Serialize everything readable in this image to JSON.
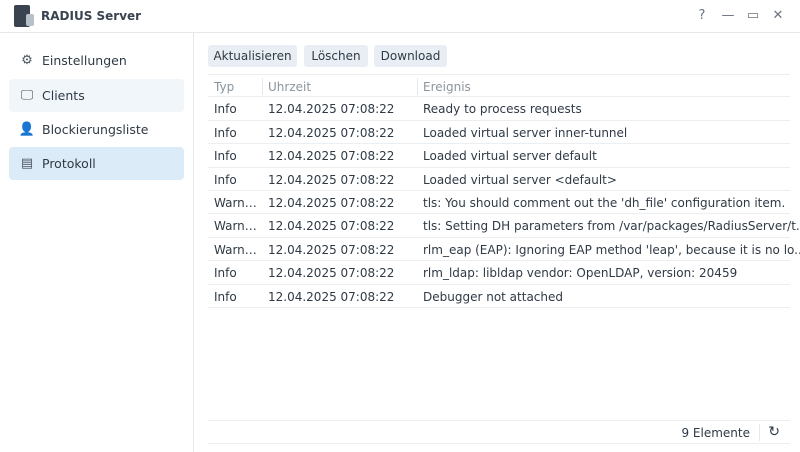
{
  "window": {
    "title": "RADIUS Server",
    "help": "?",
    "minimize": "—",
    "maximize": "▭",
    "close": "✕"
  },
  "sidebar": {
    "items": [
      {
        "label": "Einstellungen",
        "icon": "⚙"
      },
      {
        "label": "Clients",
        "icon": "🖵"
      },
      {
        "label": "Blockierungsliste",
        "icon": "👤"
      },
      {
        "label": "Protokoll",
        "icon": "▤"
      }
    ]
  },
  "toolbar": {
    "refresh": "Aktualisieren",
    "clear": "Löschen",
    "download": "Download"
  },
  "table": {
    "headers": [
      "Typ",
      "Uhrzeit",
      "Ereignis"
    ],
    "rows": [
      [
        "Info",
        "12.04.2025 07:08:22",
        "Ready to process requests"
      ],
      [
        "Info",
        "12.04.2025 07:08:22",
        "Loaded virtual server inner-tunnel"
      ],
      [
        "Info",
        "12.04.2025 07:08:22",
        "Loaded virtual server default"
      ],
      [
        "Info",
        "12.04.2025 07:08:22",
        "Loaded virtual server <default>"
      ],
      [
        "Warni...",
        "12.04.2025 07:08:22",
        "tls: You should comment out the 'dh_file' configuration item."
      ],
      [
        "Warni...",
        "12.04.2025 07:08:22",
        "tls: Setting DH parameters from /var/packages/RadiusServer/t..."
      ],
      [
        "Warni...",
        "12.04.2025 07:08:22",
        "rlm_eap (EAP): Ignoring EAP method 'leap', because it is no lo..."
      ],
      [
        "Info",
        "12.04.2025 07:08:22",
        "rlm_ldap: libldap vendor: OpenLDAP, version: 20459"
      ],
      [
        "Info",
        "12.04.2025 07:08:22",
        "Debugger not attached"
      ]
    ]
  },
  "footer": {
    "count": "9 Elemente",
    "refresh_icon": "↻"
  }
}
